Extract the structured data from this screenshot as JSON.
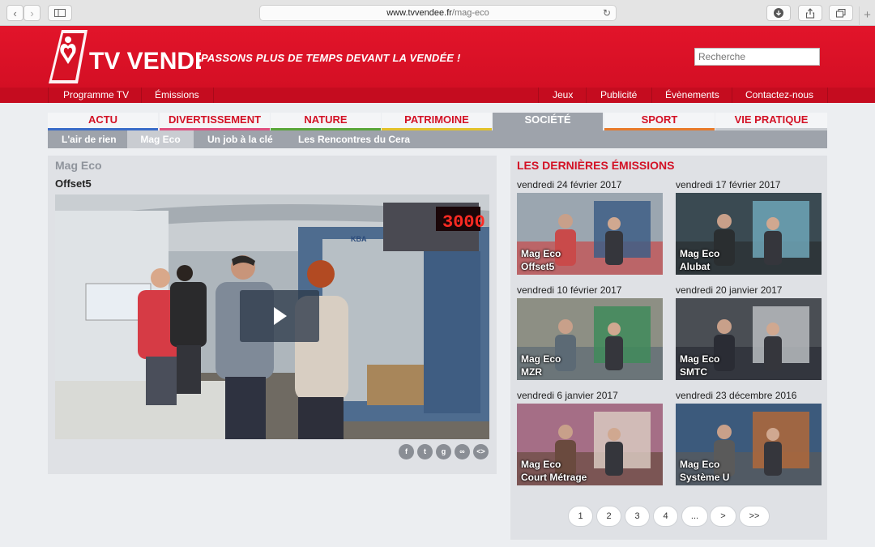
{
  "browser": {
    "url_domain": "www.tvvendee.fr",
    "url_path": "/mag-eco"
  },
  "header": {
    "logo_text": "TV VENDÉE",
    "slogan": "PASSONS PLUS DE TEMPS DEVANT LA VENDÉE !",
    "search_placeholder": "Recherche"
  },
  "topnav": {
    "left": [
      "Programme TV",
      "Émissions"
    ],
    "right": [
      "Jeux",
      "Publicité",
      "Évènements",
      "Contactez-nous"
    ]
  },
  "categories": [
    {
      "label": "ACTU",
      "color": "#3a6cc8"
    },
    {
      "label": "DIVERTISSEMENT",
      "color": "#e0507f"
    },
    {
      "label": "NATURE",
      "color": "#5aa63a"
    },
    {
      "label": "PATRIMOINE",
      "color": "#e3c22a"
    },
    {
      "label": "SOCIÉTÉ",
      "color": "#9ea3ab"
    },
    {
      "label": "SPORT",
      "color": "#e87a2a"
    },
    {
      "label": "VIE PRATIQUE",
      "color": "#c9ccd1"
    }
  ],
  "active_category": "SOCIÉTÉ",
  "subnav": [
    "L'air de rien",
    "Mag Eco",
    "Un job à la clé",
    "Les Rencontres du Cera"
  ],
  "active_subnav": "Mag Eco",
  "main": {
    "section": "Mag Eco",
    "title": "Offset5",
    "counter_display": "3000",
    "machine_brand": "KBA",
    "share_icons": [
      "facebook-icon",
      "twitter-icon",
      "google-plus-icon",
      "link-icon",
      "embed-icon"
    ]
  },
  "sidebar": {
    "heading": "LES DERNIÈRES ÉMISSIONS",
    "items": [
      {
        "date": "vendredi 24 février 2017",
        "show": "Mag Eco",
        "title": "Offset5"
      },
      {
        "date": "vendredi 17 février 2017",
        "show": "Mag Eco",
        "title": "Alubat"
      },
      {
        "date": "vendredi 10 février 2017",
        "show": "Mag Eco",
        "title": "MZR"
      },
      {
        "date": "vendredi 20 janvier 2017",
        "show": "Mag Eco",
        "title": "SMTC"
      },
      {
        "date": "vendredi 6 janvier 2017",
        "show": "Mag Eco",
        "title": "Court Métrage"
      },
      {
        "date": "vendredi 23 décembre 2016",
        "show": "Mag Eco",
        "title": "Système U"
      }
    ]
  },
  "pagination": [
    "1",
    "2",
    "3",
    "4",
    "...",
    ">",
    ">>"
  ]
}
